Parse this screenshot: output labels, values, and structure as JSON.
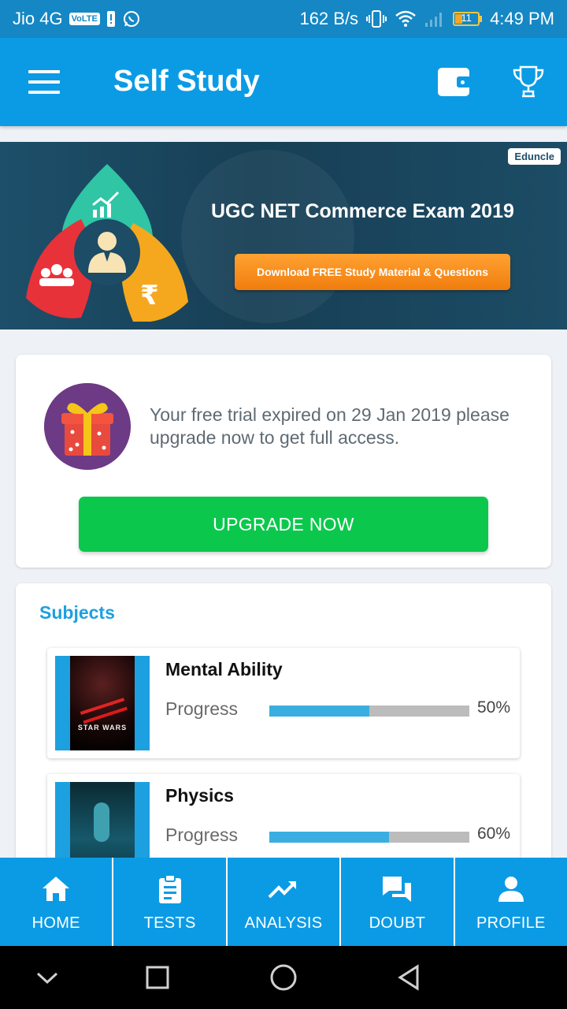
{
  "status_bar": {
    "carrier": "Jio 4G",
    "volte": "VoLTE",
    "speed": "162 B/s",
    "battery_level": "11",
    "time": "4:49 PM"
  },
  "app_bar": {
    "title": "Self Study",
    "menu_icon": "hamburger-menu-icon",
    "wallet_icon": "wallet-icon",
    "trophy_icon": "trophy-icon"
  },
  "banner": {
    "brand": "Eduncle",
    "title": "UGC NET Commerce Exam 2019",
    "cta": "Download FREE Study Material & Questions"
  },
  "trial": {
    "message": "Your free trial expired on 29 Jan 2019 please upgrade now to get full access.",
    "button": "UPGRADE NOW",
    "icon": "gift-icon"
  },
  "subjects": {
    "heading": "Subjects",
    "items": [
      {
        "name": "Mental Ability",
        "progress_label": "Progress",
        "progress": 50,
        "progress_text": "50%",
        "poster_text": "STAR WARS"
      },
      {
        "name": "Physics",
        "progress_label": "Progress",
        "progress": 60,
        "progress_text": "60%",
        "poster_text": ""
      }
    ]
  },
  "bottom_nav": {
    "items": [
      {
        "label": "HOME",
        "icon": "home-icon"
      },
      {
        "label": "TESTS",
        "icon": "clipboard-icon"
      },
      {
        "label": "ANALYSIS",
        "icon": "trending-up-icon"
      },
      {
        "label": "DOUBT",
        "icon": "chat-bubbles-icon"
      },
      {
        "label": "PROFILE",
        "icon": "person-icon"
      }
    ]
  },
  "colors": {
    "status_bar": "#1587c4",
    "primary": "#0b9be5",
    "upgrade_button": "#0bc84c",
    "banner_cta": "#f38a1c",
    "subjects_heading": "#1da0e0",
    "progress_fill": "#3aaee0",
    "progress_track": "#bcbcbc"
  }
}
